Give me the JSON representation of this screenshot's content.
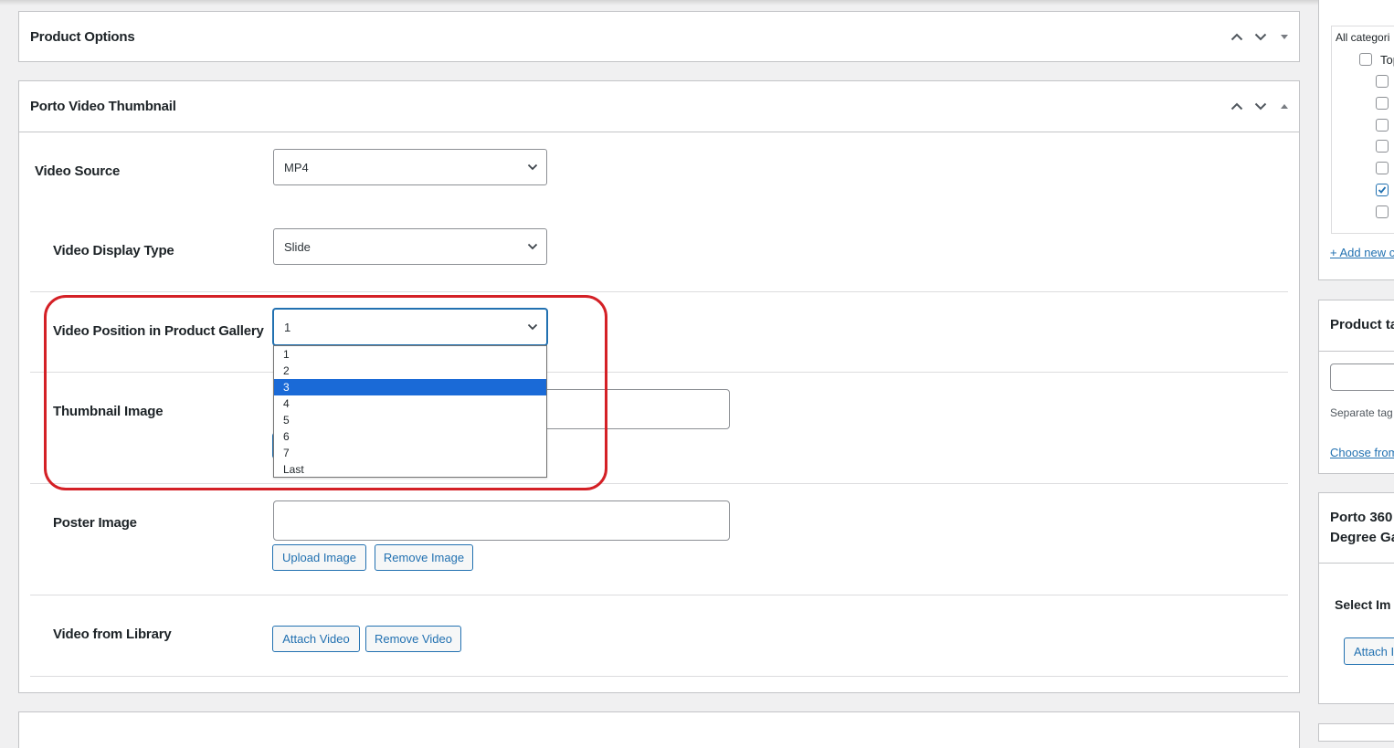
{
  "product_options": {
    "title": "Product Options"
  },
  "video_box": {
    "title": "Porto Video Thumbnail",
    "video_source": {
      "label": "Video Source",
      "value": "MP4"
    },
    "video_display_type": {
      "label": "Video Display Type",
      "value": "Slide"
    },
    "video_position": {
      "label": "Video Position in Product Gallery",
      "value": "1",
      "options": [
        "1",
        "2",
        "3",
        "4",
        "5",
        "6",
        "7",
        "Last"
      ],
      "highlighted_option": "3"
    },
    "thumbnail_image": {
      "label": "Thumbnail Image"
    },
    "poster_image": {
      "label": "Poster Image",
      "upload_label": "Upload Image",
      "remove_label": "Remove Image"
    },
    "video_library": {
      "label": "Video from Library",
      "attach_label": "Attach Video",
      "remove_label": "Remove Video"
    }
  },
  "sidebar": {
    "categories": {
      "filter_text": "All categori",
      "top_item": "Top",
      "checkbox_states": [
        false,
        false,
        false,
        false,
        false,
        true,
        false
      ],
      "add_new_link": "+ Add new c"
    },
    "product_tags": {
      "title": "Product ta",
      "help_text": "Separate tag",
      "choose_link": "Choose from"
    },
    "porto_360": {
      "title_line1": "Porto 360",
      "title_line2": "Degree Ga",
      "select_label": "Select Im",
      "attach_label": "Attach I"
    }
  },
  "colors": {
    "accent": "#2271b1",
    "highlight_ring": "#d42026",
    "selected_option": "#1a6ad7"
  },
  "icons": [
    "chevron-up-icon",
    "chevron-down-icon",
    "caret-down-icon",
    "caret-up-icon",
    "select-arrow-icon",
    "checkmark-icon"
  ]
}
